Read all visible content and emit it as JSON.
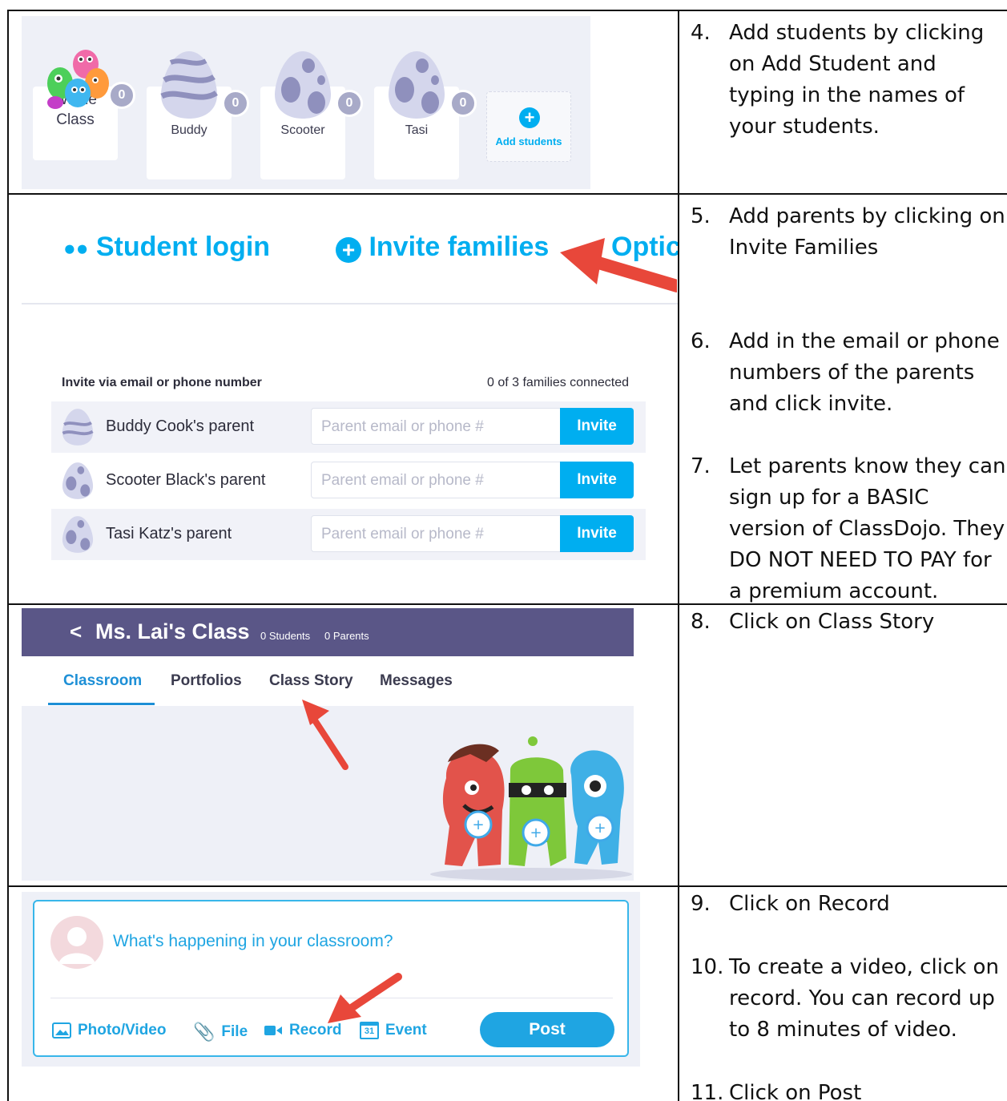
{
  "colors": {
    "brand_blue": "#00aef0",
    "class_header": "#5a5687",
    "panel_bg": "#eef0f7",
    "arrow_red": "#e8473a"
  },
  "students": {
    "cards": [
      {
        "name_line1": "Whole",
        "name_line2": "Class",
        "points": "0",
        "icon": "monsters-group-icon"
      },
      {
        "name": "Buddy",
        "points": "0",
        "icon": "egg-wavy-icon"
      },
      {
        "name": "Scooter",
        "points": "0",
        "icon": "egg-spotted-icon"
      },
      {
        "name": "Tasi",
        "points": "0",
        "icon": "egg-spotted-icon"
      }
    ],
    "add_label": "Add students",
    "add_icon": "plus-circle-icon"
  },
  "families": {
    "tab_student_login": "Student login",
    "tab_invite_families": "Invite families",
    "tab_options": "Optic",
    "invite_heading": "Invite via email or phone number",
    "connected_count": "0 of 3 families connected",
    "rows": [
      {
        "name": "Buddy Cook's parent",
        "placeholder": "Parent email or phone #",
        "button": "Invite"
      },
      {
        "name": "Scooter Black's parent",
        "placeholder": "Parent email or phone #",
        "button": "Invite"
      },
      {
        "name": "Tasi Katz's parent",
        "placeholder": "Parent email or phone #",
        "button": "Invite"
      }
    ]
  },
  "class": {
    "back_label": "<",
    "title": "Ms. Lai's Class",
    "students_count": "0 Students",
    "parents_count": "0 Parents",
    "tabs": [
      "Classroom",
      "Portfolios",
      "Class Story",
      "Messages"
    ]
  },
  "composer": {
    "prompt": "What's happening in your classroom?",
    "tools": [
      "Photo/Video",
      "File",
      "Record",
      "Event"
    ],
    "event_icon_day": "31",
    "post_label": "Post"
  },
  "instructions": [
    {
      "num": "4.",
      "text": "Add students by clicking on Add Student and typing in the names of your students."
    },
    {
      "num": "5.",
      "text": "Add parents by clicking on Invite Families"
    },
    {
      "num": "6.",
      "text": "Add in the email or phone numbers of the parents and click invite."
    },
    {
      "num": "7.",
      "text": "Let parents know they can sign up for a BASIC version of ClassDojo. They DO NOT NEED TO PAY for a premium account."
    },
    {
      "num": "8.",
      "text": "Click on Class Story"
    },
    {
      "num": "9.",
      "text": "Click on Record"
    },
    {
      "num": "10.",
      "text": "To create a video, click on record.  You can record up to 8 minutes of video."
    },
    {
      "num": "11.",
      "text": "Click on Post"
    }
  ]
}
